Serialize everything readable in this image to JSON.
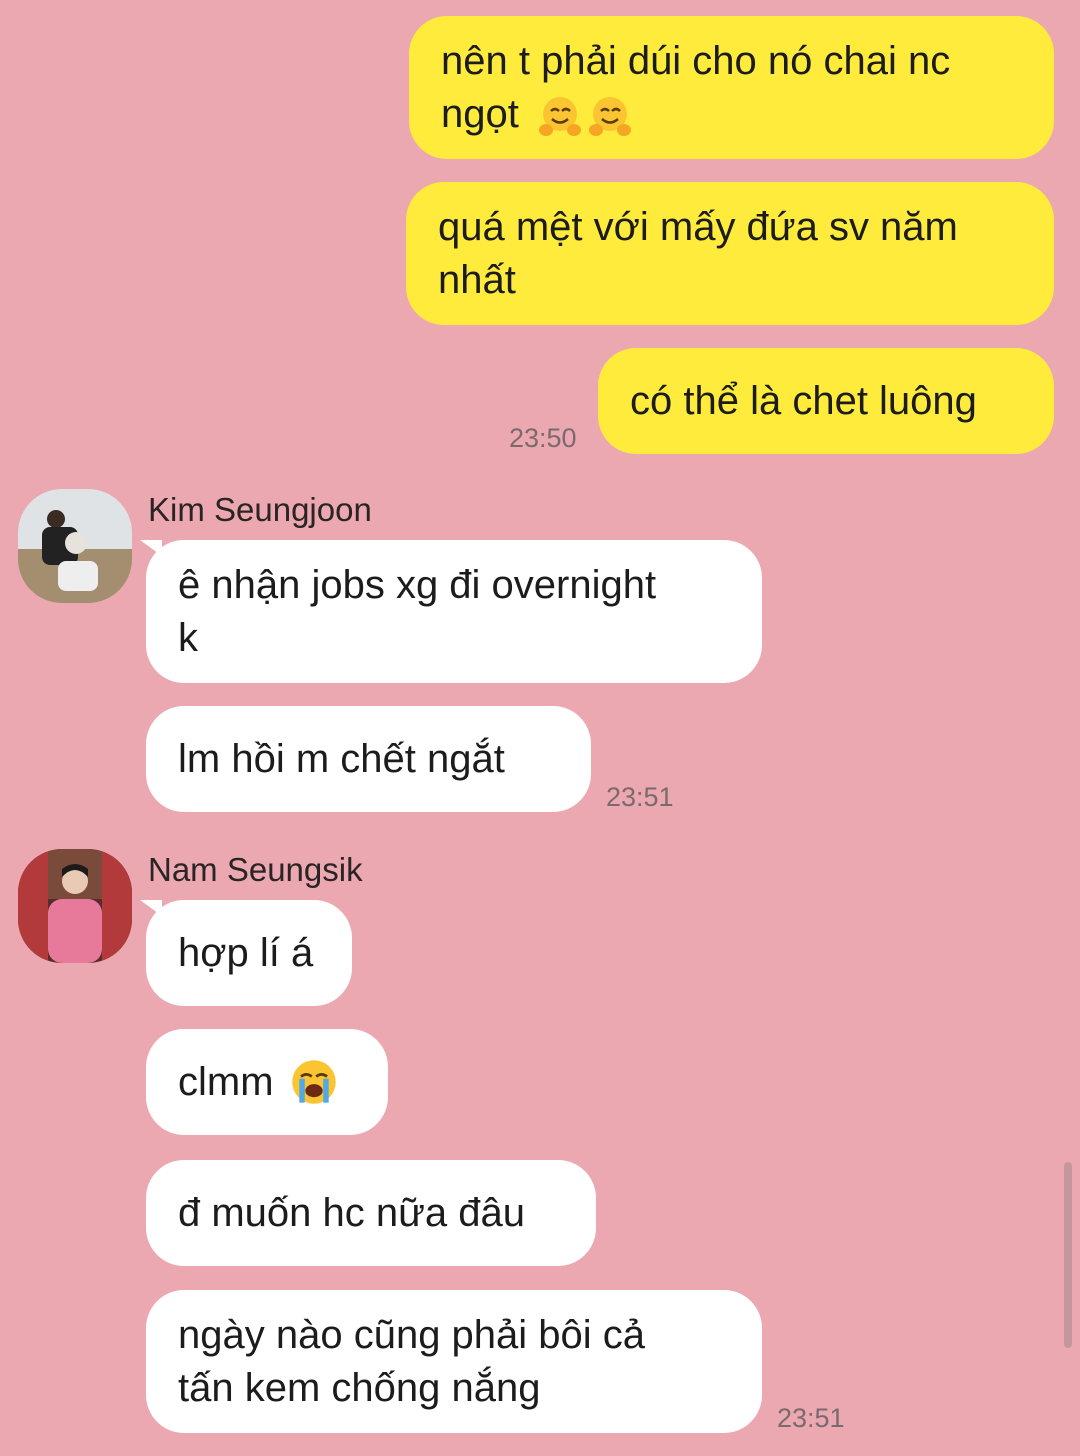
{
  "messages": {
    "m1": "nên t phải dúi cho nó chai nc\nngọt",
    "m2": "quá mệt với mấy đứa sv năm\nnhất",
    "m3": "có thể là chet luông",
    "m3_time": "23:50",
    "m4": "ê nhận jobs xg đi overnight\nk",
    "m5": "lm hồi m chết ngắt",
    "m5_time": "23:51",
    "m6": "hợp lí á",
    "m7": "clmm ",
    "m8": "đ muốn hc nữa đâu",
    "m9": "ngày nào cũng phải bôi cả\ntấn kem chống nắng",
    "m9_time": "23:51"
  },
  "senders": {
    "kim": "Kim Seungjoon",
    "nam": "Nam Seungsik"
  },
  "icons": {
    "hug": "hugging-face-emoji",
    "cry": "loudly-crying-face-emoji",
    "avatar1": "avatar-kim-seungjoon",
    "avatar2": "avatar-nam-seungsik"
  },
  "colors": {
    "background": "#eca8b1",
    "mine_bubble": "#ffeb3b",
    "their_bubble": "#ffffff"
  }
}
